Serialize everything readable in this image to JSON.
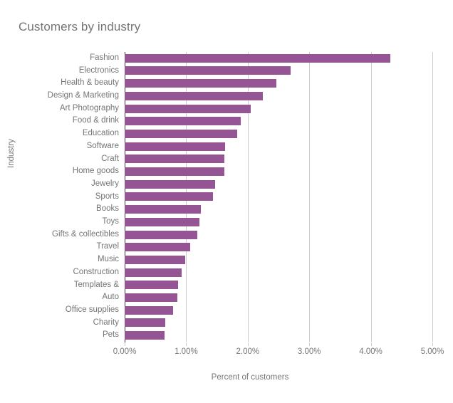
{
  "chart_data": {
    "type": "bar",
    "orientation": "horizontal",
    "title": "Customers by industry",
    "xlabel": "Percent of customers",
    "ylabel": "Industry",
    "xlim": [
      0,
      5
    ],
    "xtick_labels": [
      "0.00%",
      "1.00%",
      "2.00%",
      "3.00%",
      "4.00%",
      "5.00%"
    ],
    "xtick_values": [
      0,
      1,
      2,
      3,
      4,
      5
    ],
    "unit": "%",
    "grid": "vertical",
    "legend": "none",
    "bar_color": "#955594",
    "categories": [
      "Fashion",
      "Electronics",
      "Health & beauty",
      "Design & Marketing",
      "Art Photography",
      "Food & drink",
      "Education",
      "Software",
      "Craft",
      "Home goods",
      "Jewelry",
      "Sports",
      "Books",
      "Toys",
      "Gifts & collectibles",
      "Travel",
      "Music",
      "Construction",
      "Templates &",
      "Auto",
      "Office supplies",
      "Charity",
      "Pets"
    ],
    "values": [
      4.32,
      2.7,
      2.47,
      2.25,
      2.05,
      1.89,
      1.83,
      1.63,
      1.62,
      1.62,
      1.47,
      1.43,
      1.24,
      1.22,
      1.18,
      1.06,
      0.98,
      0.93,
      0.87,
      0.86,
      0.79,
      0.66,
      0.65
    ]
  },
  "colors": {
    "bar": "#955594",
    "text": "#757575",
    "gridline": "#cccccc",
    "axis": "#333333",
    "background": "#ffffff"
  }
}
